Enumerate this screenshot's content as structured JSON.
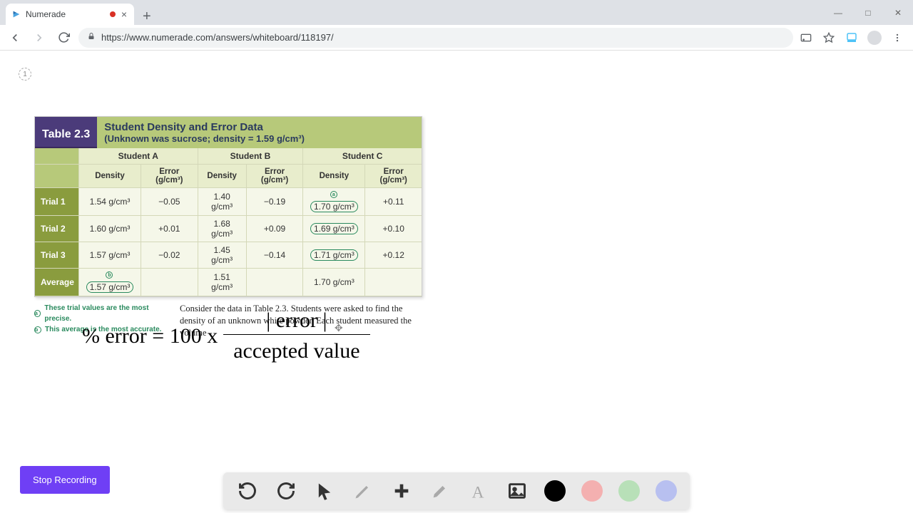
{
  "browser": {
    "tab_title": "Numerade",
    "url": "https://www.numerade.com/answers/whiteboard/118197/",
    "page_number": "1"
  },
  "table": {
    "number": "Table 2.3",
    "title": "Student Density and Error Data",
    "subtitle": "(Unknown was sucrose; density = 1.59 g/cm³)",
    "students": [
      "Student A",
      "Student B",
      "Student C"
    ],
    "subheaders": [
      "Density",
      "Error (g/cm³)"
    ],
    "rows": [
      {
        "label": "Trial 1",
        "A": {
          "d": "1.54 g/cm³",
          "e": "−0.05"
        },
        "B": {
          "d": "1.40 g/cm³",
          "e": "−0.19"
        },
        "C": {
          "d": "1.70 g/cm³",
          "e": "+0.11"
        }
      },
      {
        "label": "Trial 2",
        "A": {
          "d": "1.60 g/cm³",
          "e": "+0.01"
        },
        "B": {
          "d": "1.68 g/cm³",
          "e": "+0.09"
        },
        "C": {
          "d": "1.69 g/cm³",
          "e": "+0.10"
        }
      },
      {
        "label": "Trial 3",
        "A": {
          "d": "1.57 g/cm³",
          "e": "−0.02"
        },
        "B": {
          "d": "1.45 g/cm³",
          "e": "−0.14"
        },
        "C": {
          "d": "1.71 g/cm³",
          "e": "+0.12"
        }
      },
      {
        "label": "Average",
        "A": {
          "d": "1.57 g/cm³",
          "e": ""
        },
        "B": {
          "d": "1.51 g/cm³",
          "e": ""
        },
        "C": {
          "d": "1.70 g/cm³",
          "e": ""
        }
      }
    ],
    "footnote_a": "These trial values are the most precise.",
    "footnote_b": "This average is the most accurate.",
    "footnote_marker_a": "a",
    "footnote_marker_b": "b",
    "caption": "Consider the data in Table 2.3. Students were asked to find the density of an unknown white powder. Each student measured the volume"
  },
  "formula": {
    "lhs": "% error = 100 x",
    "numerator": "| error |",
    "denominator": "accepted value"
  },
  "buttons": {
    "stop_recording": "Stop Recording"
  }
}
